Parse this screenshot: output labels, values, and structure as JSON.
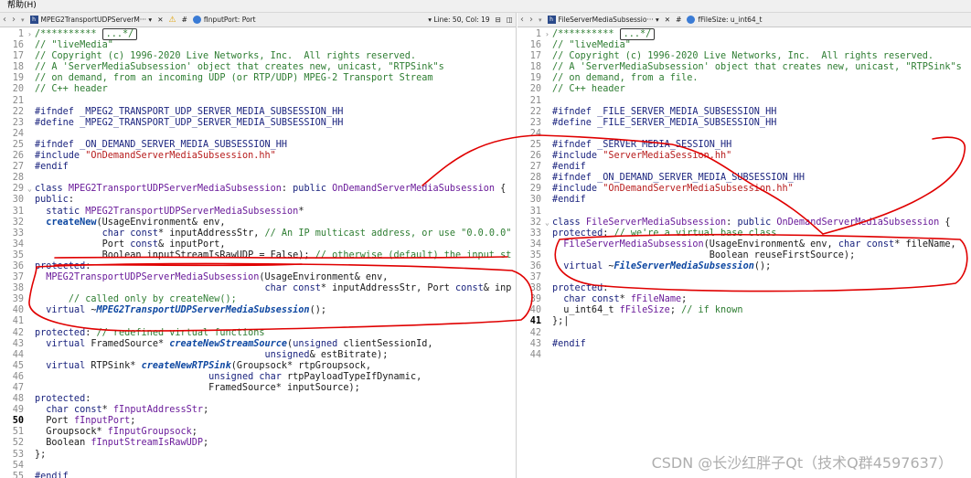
{
  "menubar": {
    "help": "帮助(H)"
  },
  "left": {
    "toolbar": {
      "file_name": "MPEG2TransportUDPServerM···",
      "func_name": "fInputPort: Port",
      "cursor": "Line: 50, Col: 19"
    },
    "lines": [
      {
        "n": "1",
        "f": ">",
        "h": "<span class=\"cm\">/********** <span class=\"box\">...*/</span></span>"
      },
      {
        "n": "16",
        "f": "",
        "h": "<span class=\"cm\">// \"liveMedia\"</span>"
      },
      {
        "n": "17",
        "f": "",
        "h": "<span class=\"cm\">// Copyright (c) 1996-2020 Live Networks, Inc.  All rights reserved.</span>"
      },
      {
        "n": "18",
        "f": "",
        "h": "<span class=\"cm\">// A 'ServerMediaSubsession' object that creates new, unicast, \"RTPSink\"s</span>"
      },
      {
        "n": "19",
        "f": "",
        "h": "<span class=\"cm\">// on demand, from an incoming UDP (or RTP/UDP) MPEG-2 Transport Stream</span>"
      },
      {
        "n": "20",
        "f": "",
        "h": "<span class=\"cm\">// C++ header</span>"
      },
      {
        "n": "21",
        "f": "",
        "h": ""
      },
      {
        "n": "22",
        "f": "",
        "h": "<span class=\"pp\">#ifndef _MPEG2_TRANSPORT_UDP_SERVER_MEDIA_SUBSESSION_HH</span>"
      },
      {
        "n": "23",
        "f": "",
        "h": "<span class=\"pp\">#define _MPEG2_TRANSPORT_UDP_SERVER_MEDIA_SUBSESSION_HH</span>"
      },
      {
        "n": "24",
        "f": "",
        "h": ""
      },
      {
        "n": "25",
        "f": "",
        "h": "<span class=\"pp\">#ifndef _ON_DEMAND_SERVER_MEDIA_SUBSESSION_HH</span>"
      },
      {
        "n": "26",
        "f": "",
        "h": "<span class=\"pp\">#include </span><span class=\"str\">\"OnDemandServerMediaSubsession.hh\"</span>"
      },
      {
        "n": "27",
        "f": "",
        "h": "<span class=\"pp\">#endif</span>"
      },
      {
        "n": "28",
        "f": "",
        "h": ""
      },
      {
        "n": "29",
        "f": "v",
        "h": "<span class=\"kw\">class</span> <span class=\"cls\">MPEG2TransportUDPServerMediaSubsession</span>: <span class=\"kw\">public</span> <span class=\"cls\">OnDemandServerMediaSubsession</span> {"
      },
      {
        "n": "30",
        "f": "",
        "h": "<span class=\"kw\">public</span>:"
      },
      {
        "n": "31",
        "f": "",
        "h": "  <span class=\"kw\">static</span> <span class=\"cls\">MPEG2TransportUDPServerMediaSubsession</span>*"
      },
      {
        "n": "32",
        "f": "",
        "h": "  <span class=\"fnc\">createNew</span>(UsageEnvironment& env,"
      },
      {
        "n": "33",
        "f": "",
        "h": "            <span class=\"ty\">char</span> <span class=\"kw\">const</span>* inputAddressStr, <span class=\"cm\">// An IP multicast address, or use \"0.0.0.0\"</span>"
      },
      {
        "n": "34",
        "f": "",
        "h": "            Port <span class=\"kw\">const</span>& inputPort,"
      },
      {
        "n": "35",
        "f": "",
        "h": "            Boolean inputStreamIsRawUDP = False); <span class=\"cm\">// otherwise (default) the input st</span>"
      },
      {
        "n": "36",
        "f": "",
        "h": "<span class=\"kw\">protected</span>:"
      },
      {
        "n": "37",
        "f": "",
        "h": "  <span class=\"cls\">MPEG2TransportUDPServerMediaSubsession</span>(UsageEnvironment& env,"
      },
      {
        "n": "38",
        "f": "",
        "h": "                                         <span class=\"ty\">char</span> <span class=\"kw\">const</span>* inputAddressStr, Port <span class=\"kw\">const</span>& inp"
      },
      {
        "n": "39",
        "f": "",
        "h": "      <span class=\"cm\">// called only by createNew();</span>"
      },
      {
        "n": "40",
        "f": "",
        "h": "  <span class=\"kw\">virtual</span> ~<span class=\"fn\">MPEG2TransportUDPServerMediaSubsession</span>();"
      },
      {
        "n": "41",
        "f": "",
        "h": ""
      },
      {
        "n": "42",
        "f": "",
        "h": "<span class=\"kw\">protected</span>: <span class=\"cm\">// redefined virtual functions</span>"
      },
      {
        "n": "43",
        "f": "",
        "h": "  <span class=\"kw\">virtual</span> FramedSource* <span class=\"fn\">createNewStreamSource</span>(<span class=\"ty\">unsigned</span> clientSessionId,"
      },
      {
        "n": "44",
        "f": "",
        "h": "                                         <span class=\"ty\">unsigned</span>& estBitrate);"
      },
      {
        "n": "45",
        "f": "",
        "h": "  <span class=\"kw\">virtual</span> RTPSink* <span class=\"fn\">createNewRTPSink</span>(Groupsock* rtpGroupsock,"
      },
      {
        "n": "46",
        "f": "",
        "h": "                               <span class=\"ty\">unsigned char</span> rtpPayloadTypeIfDynamic,"
      },
      {
        "n": "47",
        "f": "",
        "h": "                               FramedSource* inputSource);"
      },
      {
        "n": "48",
        "f": "",
        "h": "<span class=\"kw\">protected</span>:"
      },
      {
        "n": "49",
        "f": "",
        "h": "  <span class=\"ty\">char</span> <span class=\"kw\">const</span>* <span class=\"cls\">fInputAddressStr</span>;"
      },
      {
        "n": "50",
        "f": "",
        "h": "  Port <span class=\"cls\">fInputPort</span>;",
        "cur": true
      },
      {
        "n": "51",
        "f": "",
        "h": "  Groupsock* <span class=\"cls\">fInputGroupsock</span>;"
      },
      {
        "n": "52",
        "f": "",
        "h": "  Boolean <span class=\"cls\">fInputStreamIsRawUDP</span>;"
      },
      {
        "n": "53",
        "f": "",
        "h": "};"
      },
      {
        "n": "54",
        "f": "",
        "h": ""
      },
      {
        "n": "55",
        "f": "",
        "h": "<span class=\"pp\">#endif</span>"
      }
    ]
  },
  "right": {
    "toolbar": {
      "file_name": "FileServerMediaSubsessio···",
      "func_name": "fFileSize: u_int64_t"
    },
    "lines": [
      {
        "n": "1",
        "f": ">",
        "h": "<span class=\"cm\">/********** <span class=\"box\">...*/</span></span>"
      },
      {
        "n": "16",
        "f": "",
        "h": "<span class=\"cm\">// \"liveMedia\"</span>"
      },
      {
        "n": "17",
        "f": "",
        "h": "<span class=\"cm\">// Copyright (c) 1996-2020 Live Networks, Inc.  All rights reserved.</span>"
      },
      {
        "n": "18",
        "f": "",
        "h": "<span class=\"cm\">// A 'ServerMediaSubsession' object that creates new, unicast, \"RTPSink\"s</span>"
      },
      {
        "n": "19",
        "f": "",
        "h": "<span class=\"cm\">// on demand, from a file.</span>"
      },
      {
        "n": "20",
        "f": "",
        "h": "<span class=\"cm\">// C++ header</span>"
      },
      {
        "n": "21",
        "f": "",
        "h": ""
      },
      {
        "n": "22",
        "f": "",
        "h": "<span class=\"pp\">#ifndef _FILE_SERVER_MEDIA_SUBSESSION_HH</span>"
      },
      {
        "n": "23",
        "f": "",
        "h": "<span class=\"pp\">#define _FILE_SERVER_MEDIA_SUBSESSION_HH</span>"
      },
      {
        "n": "24",
        "f": "",
        "h": ""
      },
      {
        "n": "25",
        "f": "",
        "h": "<span class=\"pp\">#ifndef _SERVER_MEDIA_SESSION_HH</span>"
      },
      {
        "n": "26",
        "f": "",
        "h": "<span class=\"pp\">#include </span><span class=\"str\">\"ServerMediaSession.hh\"</span>"
      },
      {
        "n": "27",
        "f": "",
        "h": "<span class=\"pp\">#endif</span>"
      },
      {
        "n": "28",
        "f": "",
        "h": "<span class=\"pp\">#ifndef _ON_DEMAND_SERVER_MEDIA_SUBSESSION_HH</span>"
      },
      {
        "n": "29",
        "f": "",
        "h": "<span class=\"pp\">#include </span><span class=\"str\">\"OnDemandServerMediaSubsession.hh\"</span>"
      },
      {
        "n": "30",
        "f": "",
        "h": "<span class=\"pp\">#endif</span>"
      },
      {
        "n": "31",
        "f": "",
        "h": ""
      },
      {
        "n": "32",
        "f": "v",
        "h": "<span class=\"kw\">class</span> <span class=\"cls\">FileServerMediaSubsession</span>: <span class=\"kw\">public</span> <span class=\"cls\">OnDemandServerMediaSubsession</span> {"
      },
      {
        "n": "33",
        "f": "",
        "h": "<span class=\"kw\">protected</span>: <span class=\"cm\">// we're a virtual base class</span>"
      },
      {
        "n": "34",
        "f": "",
        "h": "  <span class=\"cls\">FileServerMediaSubsession</span>(UsageEnvironment& env, <span class=\"ty\">char</span> <span class=\"kw\">const</span>* fileName,"
      },
      {
        "n": "35",
        "f": "",
        "h": "                            Boolean reuseFirstSource);"
      },
      {
        "n": "36",
        "f": "",
        "h": "  <span class=\"kw\">virtual</span> ~<span class=\"fn\">FileServerMediaSubsession</span>();"
      },
      {
        "n": "37",
        "f": "",
        "h": ""
      },
      {
        "n": "38",
        "f": "",
        "h": "<span class=\"kw\">protected</span>:"
      },
      {
        "n": "39",
        "f": "",
        "h": "  <span class=\"ty\">char</span> <span class=\"kw\">const</span>* <span class=\"cls\">fFileName</span>;"
      },
      {
        "n": "40",
        "f": "",
        "h": "  u_int64_t <span class=\"cls\">fFileSize</span>; <span class=\"cm\">// if known</span>"
      },
      {
        "n": "41",
        "f": "",
        "h": "};|",
        "cur": true
      },
      {
        "n": "42",
        "f": "",
        "h": ""
      },
      {
        "n": "43",
        "f": "",
        "h": "<span class=\"pp\">#endif</span>"
      },
      {
        "n": "44",
        "f": "",
        "h": ""
      }
    ]
  },
  "watermark": "CSDN @长沙红胖子Qt（技术Q群4597637）",
  "annotation_color": "#e00000"
}
